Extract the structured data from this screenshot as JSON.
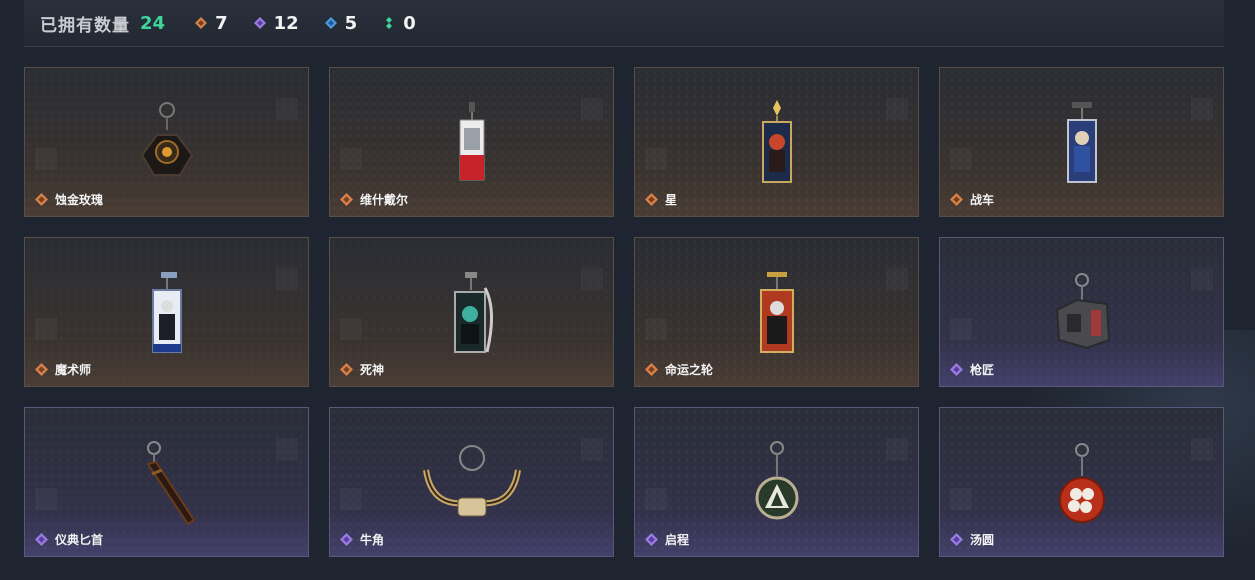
{
  "header": {
    "owned_label": "已拥有数量",
    "owned_count": "24",
    "stats": [
      {
        "rarity": "orange",
        "color": "#d9814a",
        "value": "7"
      },
      {
        "rarity": "purple",
        "color": "#9a7be0",
        "value": "12"
      },
      {
        "rarity": "blue",
        "color": "#4b9be0",
        "value": "5"
      },
      {
        "rarity": "green",
        "color": "#3fd69b",
        "value": "0"
      }
    ]
  },
  "items": [
    {
      "name": "蚀金玫瑰",
      "rarity": "orange",
      "icon": "rose-pendant-icon"
    },
    {
      "name": "维什戴尔",
      "rarity": "orange",
      "icon": "card-pendant-icon"
    },
    {
      "name": "星",
      "rarity": "orange",
      "icon": "tarot-card-icon"
    },
    {
      "name": "战车",
      "rarity": "orange",
      "icon": "tarot-card-icon"
    },
    {
      "name": "魔术师",
      "rarity": "orange",
      "icon": "tarot-card-icon"
    },
    {
      "name": "死神",
      "rarity": "orange",
      "icon": "tarot-card-icon"
    },
    {
      "name": "命运之轮",
      "rarity": "orange",
      "icon": "tarot-card-icon"
    },
    {
      "name": "枪匠",
      "rarity": "purple",
      "icon": "gun-part-pendant-icon"
    },
    {
      "name": "仪典匕首",
      "rarity": "purple",
      "icon": "dagger-pendant-icon"
    },
    {
      "name": "牛角",
      "rarity": "purple",
      "icon": "horn-pendant-icon"
    },
    {
      "name": "启程",
      "rarity": "purple",
      "icon": "badge-pendant-icon"
    },
    {
      "name": "汤圆",
      "rarity": "purple",
      "icon": "bowl-pendant-icon"
    }
  ]
}
